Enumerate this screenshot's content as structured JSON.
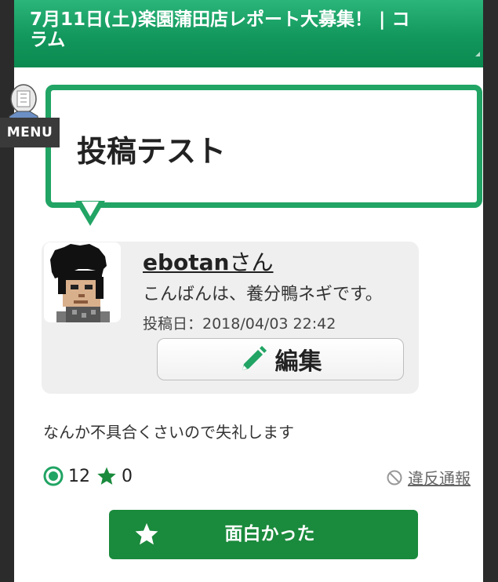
{
  "header": {
    "title_line1": "7月11日(土)楽園蒲田店レポート大募集！ | コ",
    "title_line2": "ラム"
  },
  "menu": {
    "label": "MENU"
  },
  "post": {
    "title": "投稿テスト",
    "body": "なんか不具合くさいので失礼します"
  },
  "author": {
    "name": "ebotan",
    "suffix": "さん",
    "bio": "こんばんは、養分鴨ネギです。",
    "date": "投稿日：2018/04/03 22:42"
  },
  "edit_button": {
    "label": "編集"
  },
  "stats": {
    "target_count": "12",
    "star_count": "0"
  },
  "report": {
    "label": "違反通報"
  },
  "fun_button": {
    "label": "面白かった"
  },
  "colors": {
    "accent": "#21a464",
    "button_green": "#1a8a3c"
  }
}
